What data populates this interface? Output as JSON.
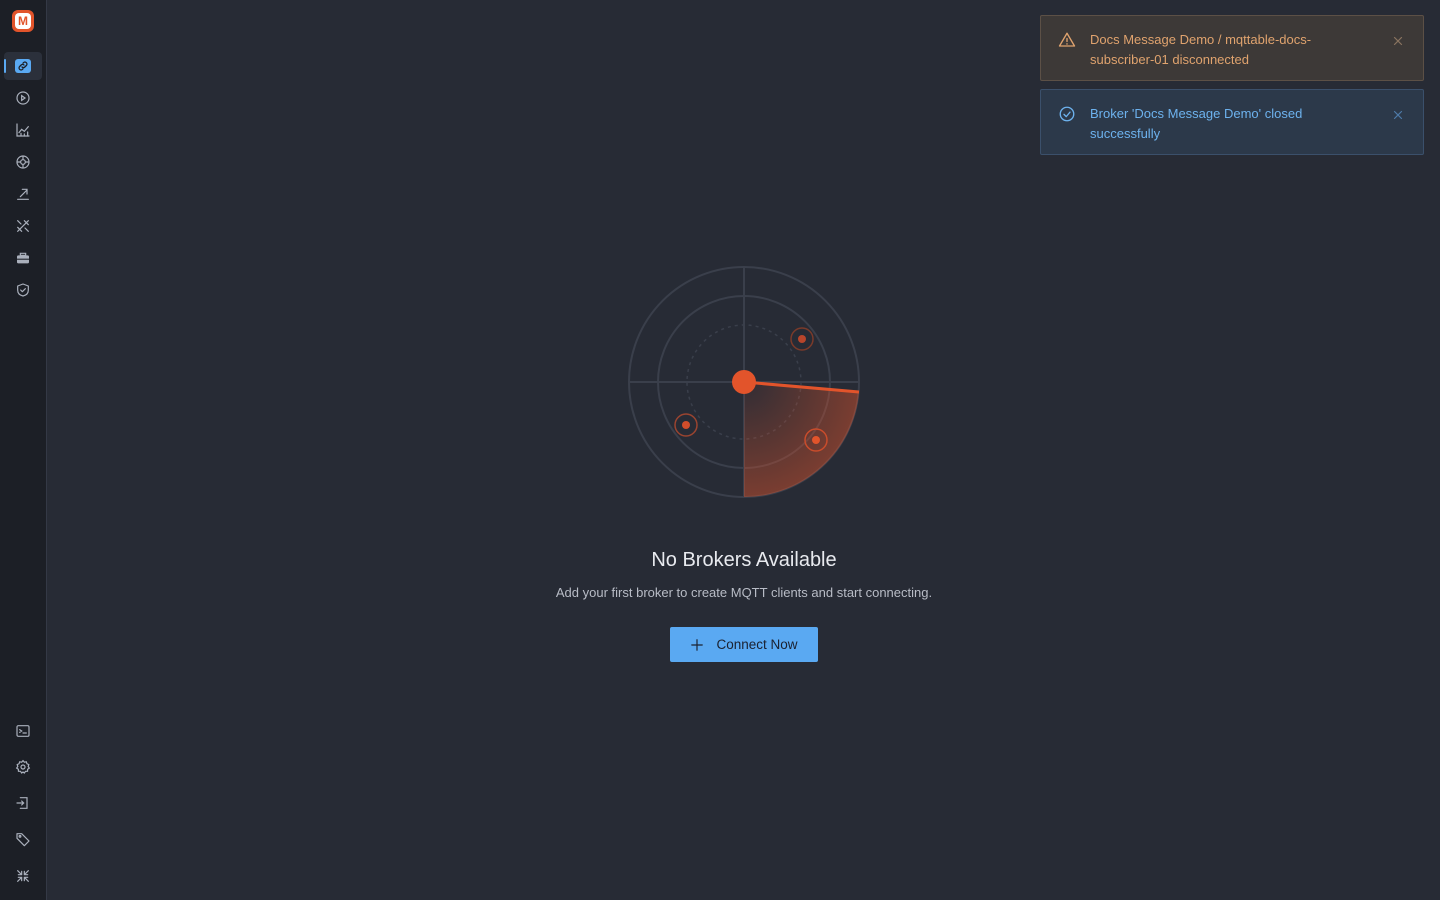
{
  "app": {
    "logo_letter": "M"
  },
  "sidebar": {
    "top_items": [
      {
        "name": "connections",
        "icon": "link-icon",
        "active": true
      },
      {
        "name": "run",
        "icon": "play-circle-icon"
      },
      {
        "name": "analytics",
        "icon": "chart-icon"
      },
      {
        "name": "schema",
        "icon": "aperture-icon"
      },
      {
        "name": "publish",
        "icon": "send-icon"
      },
      {
        "name": "tools",
        "icon": "tools-icon"
      },
      {
        "name": "toolbox",
        "icon": "briefcase-icon"
      },
      {
        "name": "security",
        "icon": "shield-check-icon"
      }
    ],
    "bottom_items": [
      {
        "name": "terminal",
        "icon": "terminal-icon"
      },
      {
        "name": "settings",
        "icon": "gear-icon"
      },
      {
        "name": "login",
        "icon": "login-icon"
      },
      {
        "name": "tags",
        "icon": "tag-icon"
      },
      {
        "name": "collapse",
        "icon": "collapse-icon"
      }
    ]
  },
  "toasts": [
    {
      "type": "warning",
      "message": "Docs Message Demo / mqttable-docs-subscriber-01 disconnected",
      "icon": "warning-triangle-icon"
    },
    {
      "type": "success",
      "message": "Broker 'Docs Message Demo' closed successfully",
      "icon": "check-circle-icon"
    }
  ],
  "empty_state": {
    "title": "No Brokers Available",
    "subtitle": "Add your first broker to create MQTT clients and start connecting.",
    "button_label": "Connect Now"
  },
  "colors": {
    "background": "#272b35",
    "sidebar": "#1c1f26",
    "accent": "#5aa9f2",
    "radar": "#e2542b",
    "warning_text": "#e0a36e",
    "success_text": "#6db2ee"
  }
}
